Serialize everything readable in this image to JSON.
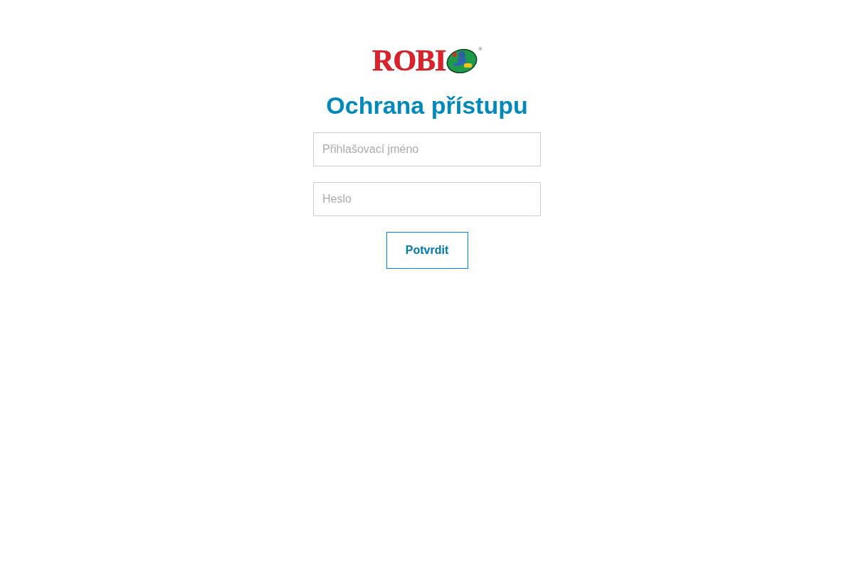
{
  "logo": {
    "text": "ROBI",
    "mark": "®"
  },
  "title": "Ochrana přístupu",
  "fields": [
    {
      "placeholder": "Přihlašovací jméno"
    },
    {
      "placeholder": "Heslo"
    }
  ],
  "button": "Potvrdit"
}
